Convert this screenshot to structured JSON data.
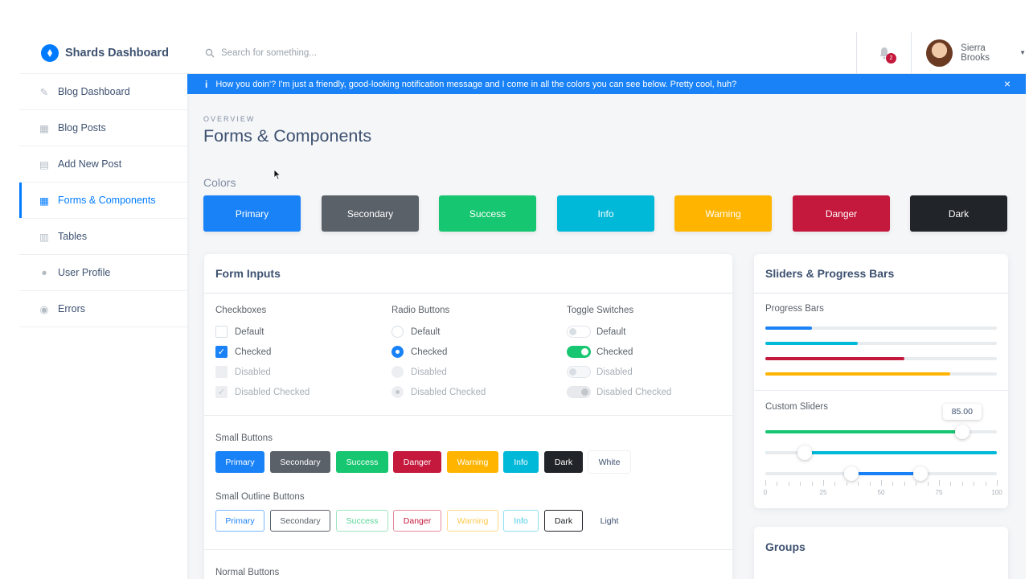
{
  "brand": {
    "title": "Shards Dashboard"
  },
  "sidebar": {
    "items": [
      {
        "label": "Blog Dashboard",
        "icon": "pencil-icon",
        "glyph": "✎"
      },
      {
        "label": "Blog Posts",
        "icon": "posts-icon",
        "glyph": "▦"
      },
      {
        "label": "Add New Post",
        "icon": "note-add-icon",
        "glyph": "▤"
      },
      {
        "label": "Forms & Components",
        "icon": "grid-icon",
        "glyph": "▦"
      },
      {
        "label": "Tables",
        "icon": "table-icon",
        "glyph": "▥"
      },
      {
        "label": "User Profile",
        "icon": "person-icon",
        "glyph": "●"
      },
      {
        "label": "Errors",
        "icon": "error-icon",
        "glyph": "◉"
      }
    ],
    "active_index": 3
  },
  "topbar": {
    "search_placeholder": "Search for something...",
    "notification_count": "2",
    "user_name": "Sierra Brooks"
  },
  "alert": {
    "icon": "info-icon",
    "message": "How you doin'? I'm just a friendly, good-looking notification message and I come in all the colors you can see below. Pretty cool, huh?",
    "close": "×"
  },
  "page": {
    "overview": "OVERVIEW",
    "title": "Forms & Components",
    "colors_title": "Colors"
  },
  "colors": [
    {
      "label": "Primary",
      "color": "#1a82f7"
    },
    {
      "label": "Secondary",
      "color": "#5a6169"
    },
    {
      "label": "Success",
      "color": "#17c671"
    },
    {
      "label": "Info",
      "color": "#00b8d8"
    },
    {
      "label": "Warning",
      "color": "#ffb400"
    },
    {
      "label": "Danger",
      "color": "#c4183c"
    },
    {
      "label": "Dark",
      "color": "#212529"
    }
  ],
  "form_inputs": {
    "title": "Form Inputs",
    "checkboxes": {
      "title": "Checkboxes",
      "items": [
        "Default",
        "Checked",
        "Disabled",
        "Disabled Checked"
      ]
    },
    "radios": {
      "title": "Radio Buttons",
      "items": [
        "Default",
        "Checked",
        "Disabled",
        "Disabled Checked"
      ]
    },
    "toggles": {
      "title": "Toggle Switches",
      "items": [
        "Default",
        "Checked",
        "Disabled",
        "Disabled Checked"
      ]
    },
    "small_buttons": {
      "title": "Small Buttons",
      "items": [
        "Primary",
        "Secondary",
        "Success",
        "Danger",
        "Warning",
        "Info",
        "Dark",
        "White"
      ]
    },
    "small_outline_buttons": {
      "title": "Small Outline Buttons",
      "items": [
        "Primary",
        "Secondary",
        "Success",
        "Danger",
        "Warning",
        "Info",
        "Dark",
        "Light"
      ]
    },
    "normal_buttons": {
      "title": "Normal Buttons"
    }
  },
  "sliders": {
    "title": "Sliders & Progress Bars",
    "progress_title": "Progress Bars",
    "progress": [
      {
        "value": 0.2,
        "color": "#1a82f7"
      },
      {
        "value": 0.4,
        "color": "#00b8d8"
      },
      {
        "value": 0.6,
        "color": "#c4183c"
      },
      {
        "value": 0.8,
        "color": "#ffb400"
      }
    ],
    "custom_title": "Custom Sliders",
    "slider1": {
      "value": 85,
      "tooltip": "85.00",
      "color": "#17c671"
    },
    "slider2": {
      "value": 17,
      "color": "#00b8d8"
    },
    "slider3": {
      "low": 37,
      "high": 67,
      "color": "#1a82f7"
    },
    "scale_labels": [
      "0",
      "25",
      "50",
      "75",
      "100"
    ]
  },
  "groups": {
    "title": "Groups"
  }
}
